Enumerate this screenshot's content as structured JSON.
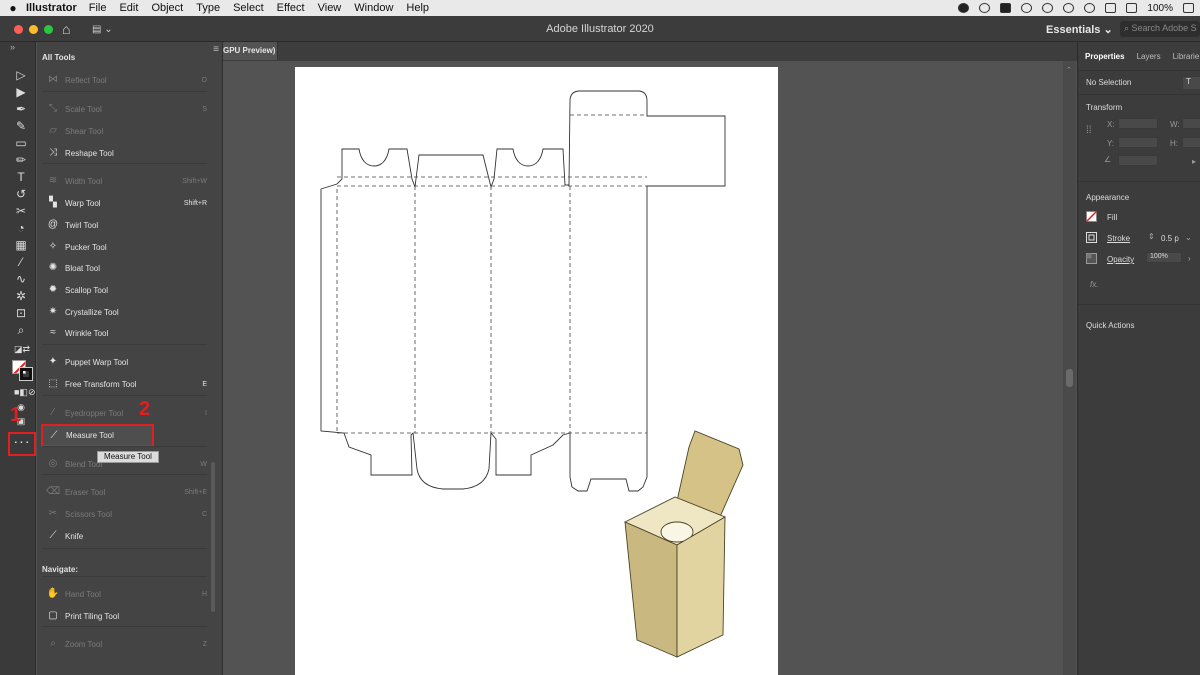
{
  "menubar": {
    "apple": "",
    "app": "Illustrator",
    "items": [
      "File",
      "Edit",
      "Object",
      "Type",
      "Select",
      "Effect",
      "View",
      "Window",
      "Help"
    ],
    "battery": "100%"
  },
  "titlebar": {
    "title": "Adobe Illustrator 2020",
    "workspace": "Essentials ⌄",
    "search_placeholder": "Search Adobe S"
  },
  "doc_tab": {
    "label": "GPU Preview)"
  },
  "all_tools": {
    "heading": "All Tools",
    "tools": [
      {
        "label": "Reflect Tool",
        "key": "O",
        "dim": true,
        "icon": "reflect-icon"
      },
      {
        "label": "Scale Tool",
        "key": "S",
        "dim": true,
        "icon": "scale-icon"
      },
      {
        "label": "Shear Tool",
        "key": "",
        "dim": true,
        "icon": "shear-icon"
      },
      {
        "label": "Reshape Tool",
        "key": "",
        "dim": false,
        "icon": "reshape-icon"
      },
      {
        "label": "Width Tool",
        "key": "Shift+W",
        "dim": true,
        "icon": "width-icon"
      },
      {
        "label": "Warp Tool",
        "key": "Shift+R",
        "dim": false,
        "icon": "warp-icon"
      },
      {
        "label": "Twirl Tool",
        "key": "",
        "dim": false,
        "icon": "twirl-icon"
      },
      {
        "label": "Pucker Tool",
        "key": "",
        "dim": false,
        "icon": "pucker-icon"
      },
      {
        "label": "Bloat Tool",
        "key": "",
        "dim": false,
        "icon": "bloat-icon"
      },
      {
        "label": "Scallop Tool",
        "key": "",
        "dim": false,
        "icon": "scallop-icon"
      },
      {
        "label": "Crystallize Tool",
        "key": "",
        "dim": false,
        "icon": "crystallize-icon"
      },
      {
        "label": "Wrinkle Tool",
        "key": "",
        "dim": false,
        "icon": "wrinkle-icon"
      },
      {
        "label": "Puppet Warp Tool",
        "key": "",
        "dim": false,
        "icon": "puppet-warp-icon"
      },
      {
        "label": "Free Transform Tool",
        "key": "E",
        "dim": false,
        "icon": "free-transform-icon"
      },
      {
        "label": "Eyedropper Tool",
        "key": "I",
        "dim": true,
        "icon": "eyedropper-icon"
      },
      {
        "label": "Measure Tool",
        "key": "",
        "dim": false,
        "icon": "measure-icon",
        "selected": true
      },
      {
        "label": "Blend Tool",
        "key": "W",
        "dim": true,
        "icon": "blend-icon"
      },
      {
        "label": "Eraser Tool",
        "key": "Shift+E",
        "dim": true,
        "icon": "eraser-icon"
      },
      {
        "label": "Scissors Tool",
        "key": "C",
        "dim": true,
        "icon": "scissors-icon"
      },
      {
        "label": "Knife",
        "key": "",
        "dim": false,
        "icon": "knife-icon"
      },
      {
        "label": "Hand Tool",
        "key": "H",
        "dim": true,
        "icon": "hand-icon"
      },
      {
        "label": "Print Tiling Tool",
        "key": "",
        "dim": false,
        "icon": "print-tiling-icon"
      },
      {
        "label": "Zoom Tool",
        "key": "Z",
        "dim": true,
        "icon": "zoom-icon"
      }
    ],
    "navigate_heading": "Navigate:",
    "tooltip": "Measure Tool"
  },
  "annotations": {
    "marker_1": "1",
    "marker_2": "2"
  },
  "properties": {
    "tabs": [
      "Properties",
      "Layers",
      "Librarie"
    ],
    "no_selection": "No Selection",
    "transform_heading": "Transform",
    "x_label": "X:",
    "y_label": "Y:",
    "w_label": "W:",
    "h_label": "H:",
    "appearance_heading": "Appearance",
    "fill_label": "Fill",
    "stroke_label": "Stroke",
    "stroke_value": "0.5 p",
    "opacity_label": "Opacity",
    "opacity_value": "100%",
    "fx_label": "fx.",
    "quick_actions_heading": "Quick Actions",
    "trunc_button": "T"
  },
  "colors": {
    "annotation_red": "#e02020",
    "box_face_light": "#e8dcae",
    "box_face_mid": "#d7c68e",
    "box_face_dark": "#bfae78"
  }
}
